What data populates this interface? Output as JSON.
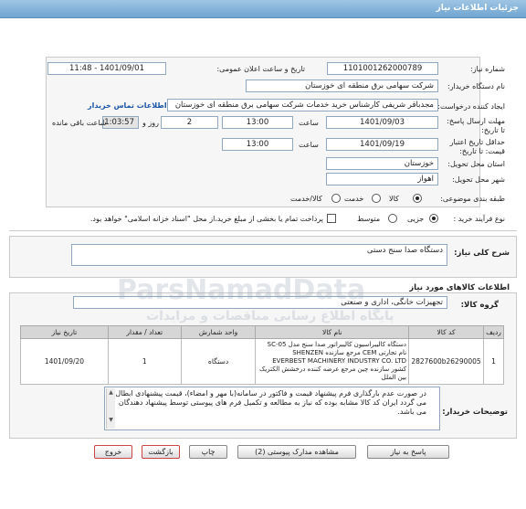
{
  "header": {
    "title": "جزئیات اطلاعات نیاز"
  },
  "form": {
    "need_number_label": "شماره نیاز:",
    "need_number": "1101001262000789",
    "announce_label": "تاریخ و ساعت اعلان عمومی:",
    "announce_value": "1401/09/01 - 11:48",
    "buyer_label": "نام دستگاه خریدار:",
    "buyer_value": "شرکت سهامی برق منطقه ای خوزستان",
    "requester_label": "ایجاد کننده درخواست:",
    "requester_value": "مجدباقر شریفی کارشناس خرید خدمات شرکت سهامی برق منطقه ای خوزستان",
    "contact_link": "اطلاعات تماس خریدار",
    "deadline_label": "مهلت ارسال پاسخ: تا تاریخ:",
    "deadline_date": "1401/09/03",
    "time_label": "ساعت",
    "deadline_time": "13:00",
    "days_value": "2",
    "days_label": "روز و",
    "remaining_time": "01:03:57",
    "remaining_label": "ساعت باقی مانده",
    "validity_label": "حداقل تاریخ اعتبار قیمت: تا تاریخ:",
    "validity_date": "1401/09/19",
    "validity_time_label": "ساعت",
    "validity_time": "13:00",
    "province_label": "استان محل تحویل:",
    "province_value": "خوزستان",
    "city_label": "شهر محل تحویل:",
    "city_value": "اهواز",
    "category_label": "طبقه بندی موضوعی:",
    "category_options": [
      "کالا",
      "خدمت",
      "کالا/خدمت"
    ],
    "process_label": "نوع فرآیند خرید :",
    "process_options": [
      "جزیی",
      "متوسط"
    ],
    "payment_note": "پرداخت تمام یا بخشی از مبلغ خرید،از محل \"اسناد خزانه اسلامی\" خواهد بود."
  },
  "summary": {
    "label": "شرح کلی نیاز:",
    "value": "دستگاه صدا سنج دستی"
  },
  "goods": {
    "title": "اطلاعات کالاهای مورد نیاز",
    "group_label": "گروه کالا:",
    "group_value": "تجهیزات خانگی، اداری و صنعتی",
    "columns": [
      "ردیف",
      "کد کالا",
      "نام کالا",
      "واحد شمارش",
      "تعداد / مقدار",
      "تاریخ نیاز"
    ],
    "rows": [
      {
        "row": "1",
        "code": "2827600b26290005",
        "name": "دستگاه کالیبراسیون کالیبراتور صدا سنج مدل SC-05 نام تجارتی CEM مرجع سازنده SHENZEN EVERBEST MACHINERY INDUSTRY CO. LTD کشور سازنده چین مرجع عرضه کننده درخشش الکتریک بین الملل",
        "unit": "دستگاه",
        "qty": "1",
        "date": "1401/09/20"
      }
    ]
  },
  "notes": {
    "label": "توضیحات خریدار:",
    "text": "در صورت عدم بارگذاری فرم پیشنهاد قیمت و فاکتور در سامانه(با مهر و امضاء)، قیمت پیشنهادی ابطال می گردد ایران کد کالا مشابه بوده که نیاز به مطالعه و تکمیل فرم های پیوستی توسط پیشنهاد دهندگان می باشد."
  },
  "buttons": {
    "reply": "پاسخ به نیاز",
    "docs": "مشاهده مدارک پیوستی (2)",
    "print": "چاپ",
    "back": "بازگشت",
    "exit": "خروج"
  },
  "watermark": {
    "brand": "ParsNamadData",
    "tagline": "پایگاه اطلاع رسانی مناقصات و مزایدات"
  }
}
